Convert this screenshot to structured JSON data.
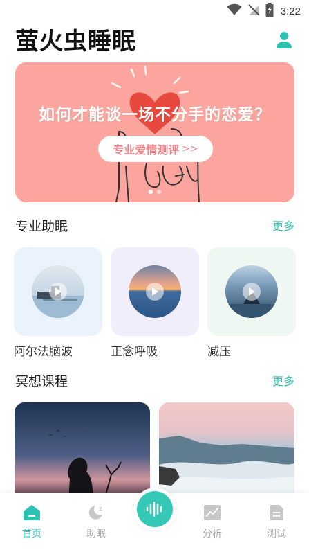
{
  "status_bar": {
    "time": "3:22",
    "icons": [
      "wifi-icon",
      "signal-off-icon",
      "battery-charging-icon"
    ]
  },
  "header": {
    "title": "萤火虫睡眠",
    "profile_icon": "user-icon"
  },
  "banner": {
    "headline": "如何才能谈一场不分手的恋爱？",
    "cta_label": "专业爱情测评",
    "cta_arrow": ">>",
    "background": "#fca59f",
    "slides": 2,
    "active_slide": 1
  },
  "sleep_aid": {
    "title": "专业助眠",
    "more": "更多",
    "items": [
      {
        "label": "阿尔法脑波",
        "bg": "#eaf3fb"
      },
      {
        "label": "正念呼吸",
        "bg": "#f1eefb"
      },
      {
        "label": "减压",
        "bg": "#eef7f2"
      }
    ]
  },
  "meditation": {
    "title": "冥想课程",
    "more": "更多"
  },
  "bottom_nav": {
    "items": [
      {
        "label": "首页",
        "icon": "home-icon",
        "active": true
      },
      {
        "label": "助眠",
        "icon": "moon-sleep-icon",
        "active": false
      },
      {
        "label": "分析",
        "icon": "chart-icon",
        "active": false
      },
      {
        "label": "测试",
        "icon": "document-icon",
        "active": false
      }
    ],
    "center_icon": "sound-wave-icon"
  },
  "colors": {
    "accent": "#2ec2b3",
    "inactive": "#aaaaaa"
  }
}
